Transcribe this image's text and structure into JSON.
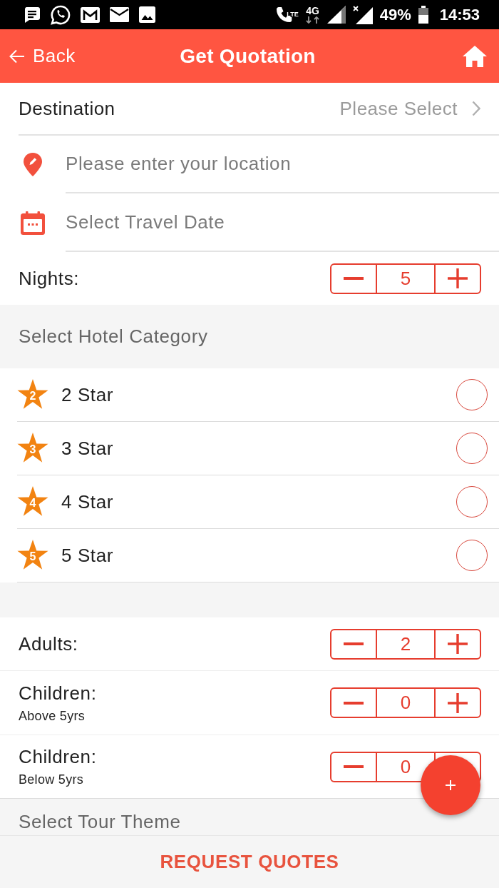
{
  "status_bar": {
    "call_label": "LTE",
    "network": "4G",
    "battery": "49%",
    "time": "14:53"
  },
  "header": {
    "back": "Back",
    "title": "Get Quotation"
  },
  "destination": {
    "label": "Destination",
    "value": "Please Select"
  },
  "location": {
    "placeholder": "Please enter your location"
  },
  "travel_date": {
    "placeholder": "Select Travel Date"
  },
  "nights": {
    "label": "Nights:",
    "value": "5"
  },
  "hotel_category": {
    "heading": "Select Hotel Category",
    "options": [
      {
        "badge": "2",
        "label": "2 Star",
        "selected": false
      },
      {
        "badge": "3",
        "label": "3 Star",
        "selected": false
      },
      {
        "badge": "4",
        "label": "4 Star",
        "selected": false
      },
      {
        "badge": "5",
        "label": "5 Star",
        "selected": false
      }
    ]
  },
  "travellers": [
    {
      "label": "Adults:",
      "value": "2"
    },
    {
      "label": "Children:",
      "note": "Above 5yrs",
      "value": "0"
    },
    {
      "label": "Children:",
      "note": "Below 5yrs",
      "value": "0"
    }
  ],
  "tour_theme": {
    "heading": "Select Tour Theme"
  },
  "request_button": "REQUEST QUOTES"
}
